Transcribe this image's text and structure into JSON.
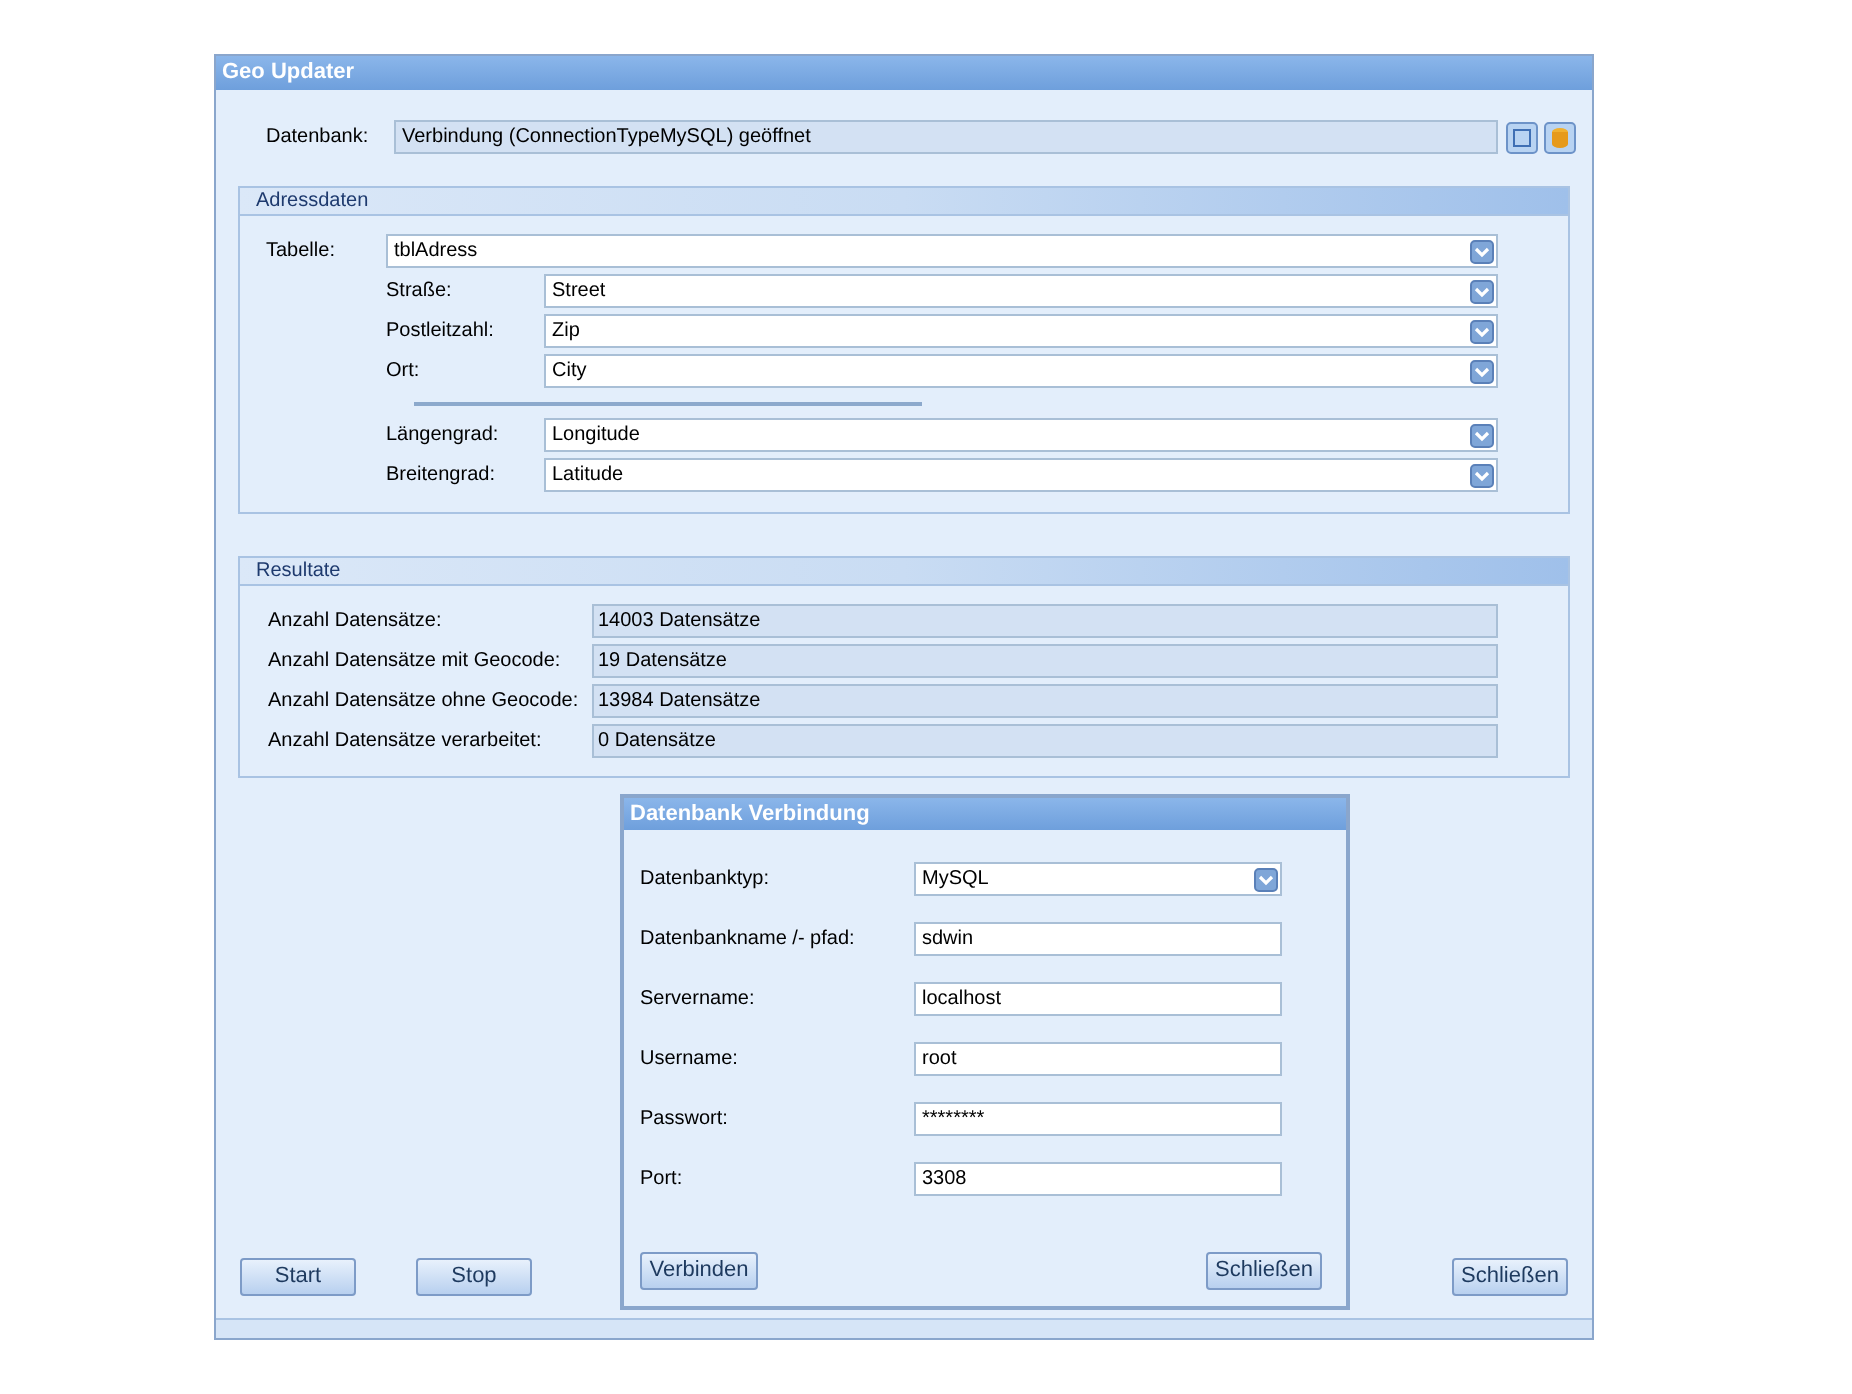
{
  "window": {
    "title": "Geo Updater"
  },
  "datenbank": {
    "label": "Datenbank:",
    "value": "Verbindung (ConnectionTypeMySQL) geöffnet"
  },
  "adressdaten": {
    "title": "Adressdaten",
    "table": {
      "label": "Tabelle:",
      "value": "tblAdress"
    },
    "columns": [
      {
        "label": "Straße:",
        "value": "Street"
      },
      {
        "label": "Postleitzahl:",
        "value": "Zip"
      },
      {
        "label": "Ort:",
        "value": "City"
      }
    ],
    "geo_columns": [
      {
        "label": "Längengrad:",
        "value": "Longitude"
      },
      {
        "label": "Breitengrad:",
        "value": "Latitude"
      }
    ]
  },
  "resultate": {
    "title": "Resultate",
    "rows": [
      {
        "label": "Anzahl Datensätze:",
        "value": "14003 Datensätze"
      },
      {
        "label": "Anzahl Datensätze mit Geocode:",
        "value": "19 Datensätze"
      },
      {
        "label": "Anzahl Datensätze ohne Geocode:",
        "value": "13984 Datensätze"
      },
      {
        "label": "Anzahl Datensätze verarbeitet:",
        "value": "0 Datensätze"
      }
    ]
  },
  "buttons": {
    "start": "Start",
    "stop": "Stop",
    "close": "Schließen"
  },
  "dialog": {
    "title": "Datenbank Verbindung",
    "fields": [
      {
        "kind": "dropdown",
        "label": "Datenbanktyp:",
        "value": "MySQL"
      },
      {
        "kind": "text",
        "label": "Datenbankname /- pfad:",
        "value": "sdwin"
      },
      {
        "kind": "text",
        "label": "Servername:",
        "value": "localhost"
      },
      {
        "kind": "text",
        "label": "Username:",
        "value": "root"
      },
      {
        "kind": "text",
        "label": "Passwort:",
        "value": "********"
      },
      {
        "kind": "text",
        "label": "Port:",
        "value": "3308"
      }
    ],
    "buttons": {
      "connect": "Verbinden",
      "close": "Schließen"
    }
  }
}
